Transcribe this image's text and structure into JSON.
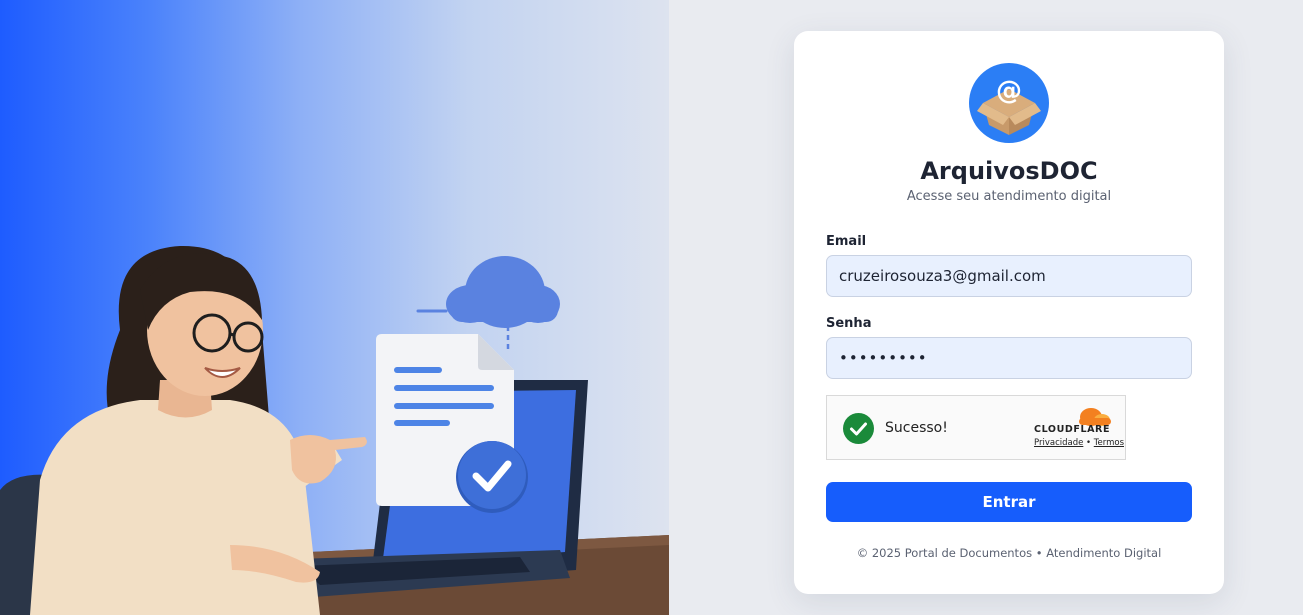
{
  "brand": {
    "title": "ArquivosDOC",
    "subtitle": "Acesse seu atendimento digital",
    "logo_icon": "at-sign-box-icon"
  },
  "form": {
    "email_label": "Email",
    "email_value": "cruzeirosouza3@gmail.com",
    "password_label": "Senha",
    "password_value": "•••••••••",
    "submit_label": "Entrar"
  },
  "captcha": {
    "status_text": "Sucesso!",
    "brand": "CLOUDFLARE",
    "privacy_link": "Privacidade",
    "separator": " • ",
    "terms_link": "Termos"
  },
  "footer": {
    "text": "© 2025 Portal de Documentos • Atendimento Digital"
  },
  "colors": {
    "primary": "#165dfc",
    "input_bg": "#e8f0fe",
    "success": "#1a8a3a",
    "cloudflare_orange": "#f38020"
  }
}
